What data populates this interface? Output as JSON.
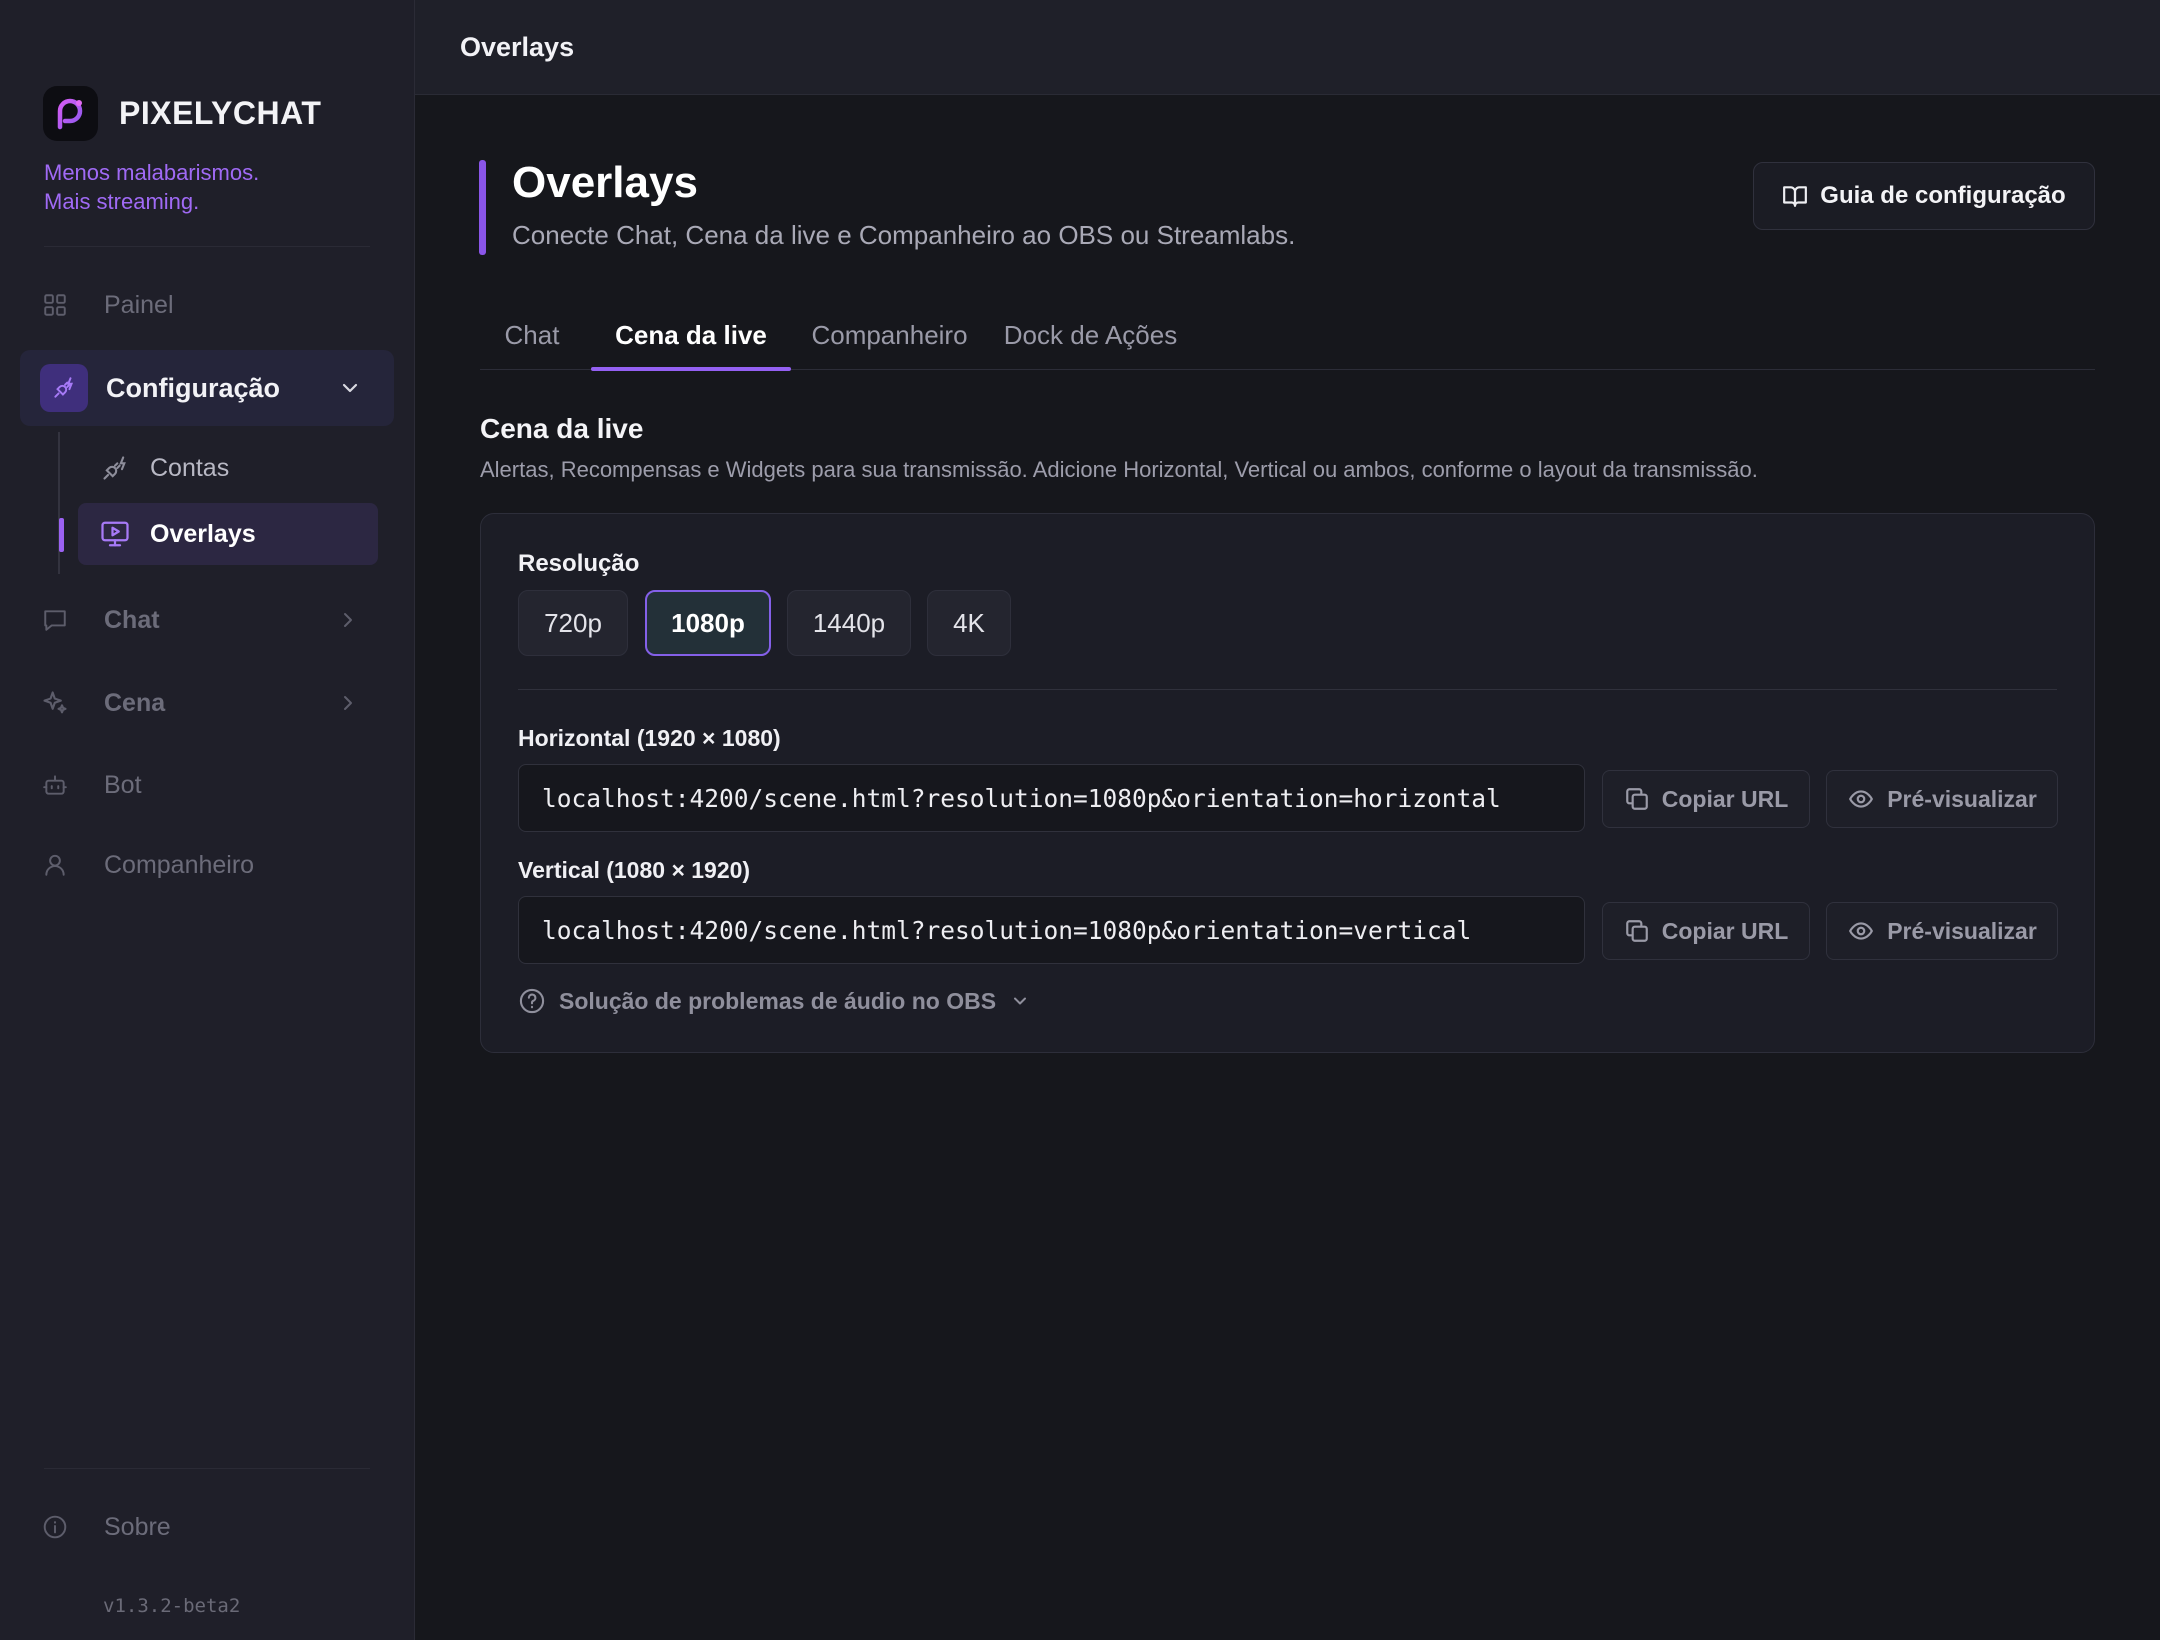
{
  "app": {
    "brand_name": "PIXELYCHAT",
    "tagline_line1": "Menos malabarismos.",
    "tagline_line2": "Mais streaming.",
    "version": "v1.3.2-beta2"
  },
  "colors": {
    "accent": "#9460f2",
    "sidebar_bg": "#1f1f29",
    "main_bg": "#16171c",
    "tagline": "#a06af5"
  },
  "sidebar": {
    "painel": {
      "label": "Painel",
      "icon": "grid-icon"
    },
    "configuracao": {
      "label": "Configuração",
      "icon": "plug-icon",
      "expanded": true
    },
    "contas": {
      "label": "Contas",
      "icon": "plug-icon"
    },
    "overlays": {
      "label": "Overlays",
      "icon": "monitor-play-icon",
      "active": true
    },
    "chat": {
      "label": "Chat",
      "icon": "message-icon"
    },
    "cena": {
      "label": "Cena",
      "icon": "sparkles-icon"
    },
    "bot": {
      "label": "Bot",
      "icon": "bot-icon"
    },
    "companheiro": {
      "label": "Companheiro",
      "icon": "user-icon"
    },
    "sobre": {
      "label": "Sobre",
      "icon": "info-icon"
    }
  },
  "topbar": {
    "title": "Overlays"
  },
  "page": {
    "title": "Overlays",
    "subtitle": "Conecte Chat, Cena da live e Companheiro ao OBS ou Streamlabs.",
    "guide_button": "Guia de configuração"
  },
  "tabs": [
    {
      "label": "Chat",
      "active": false
    },
    {
      "label": "Cena da live",
      "active": true
    },
    {
      "label": "Companheiro",
      "active": false
    },
    {
      "label": "Dock de Ações",
      "active": false
    }
  ],
  "section": {
    "title": "Cena da live",
    "description": "Alertas, Recompensas e Widgets para sua transmissão. Adicione Horizontal, Vertical ou ambos, conforme o layout da transmissão."
  },
  "resolution": {
    "label": "Resolução",
    "options": [
      "720p",
      "1080p",
      "1440p",
      "4K"
    ],
    "selected": "1080p"
  },
  "horizontal": {
    "label": "Horizontal (1920 × 1080)",
    "url": "localhost:4200/scene.html?resolution=1080p&orientation=horizontal",
    "copy_label": "Copiar URL",
    "preview_label": "Pré-visualizar"
  },
  "vertical": {
    "label": "Vertical (1080 × 1920)",
    "url": "localhost:4200/scene.html?resolution=1080p&orientation=vertical",
    "copy_label": "Copiar URL",
    "preview_label": "Pré-visualizar"
  },
  "troubleshoot": {
    "label": "Solução de problemas de áudio no OBS"
  }
}
